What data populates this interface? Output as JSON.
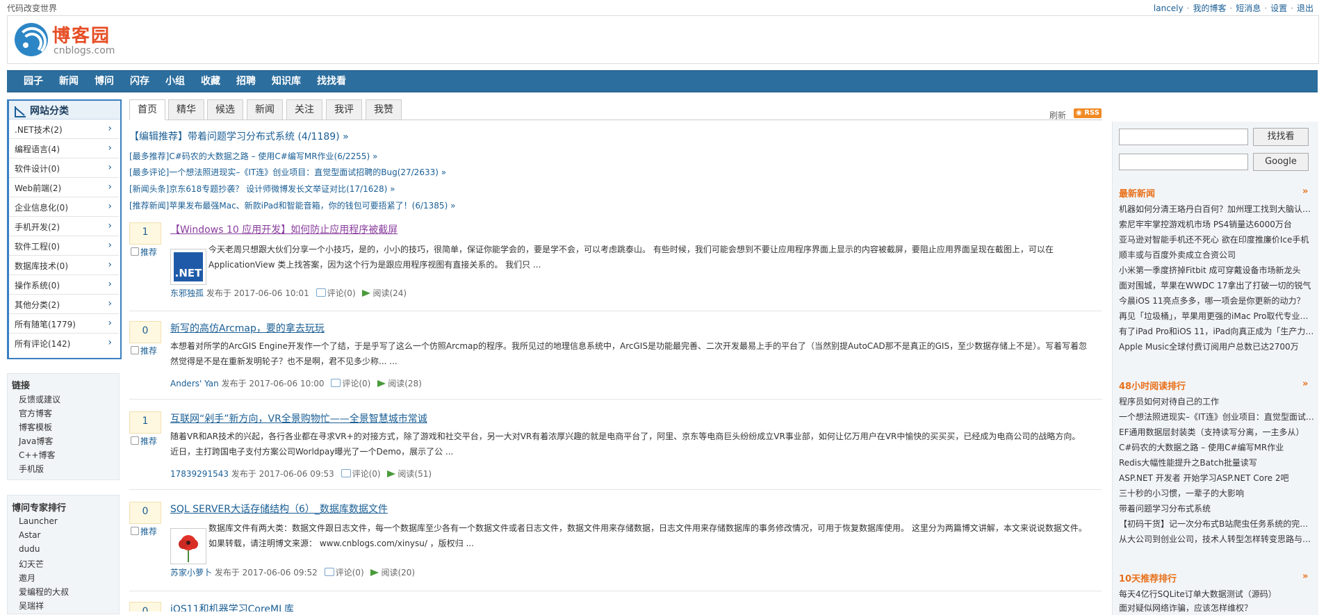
{
  "topbar": {
    "slogan": "代码改变世界",
    "links": [
      "lancely",
      "我的博客",
      "短消息",
      "设置",
      "退出"
    ]
  },
  "header": {
    "logo_title": "博客园",
    "logo_sub": "cnblogs.com"
  },
  "nav": [
    "园子",
    "新闻",
    "博问",
    "闪存",
    "小组",
    "收藏",
    "招聘",
    "知识库",
    "找找看"
  ],
  "categories": {
    "title": "网站分类",
    "items": [
      ".NET技术(2)",
      "编程语言(4)",
      "软件设计(0)",
      "Web前端(2)",
      "企业信息化(0)",
      "手机开发(2)",
      "软件工程(0)",
      "数据库技术(0)",
      "操作系统(0)",
      "其他分类(2)",
      "所有随笔(1779)",
      "所有评论(142)"
    ]
  },
  "links_box": {
    "title": "链接",
    "items": [
      "反馈或建议",
      "官方博客",
      "博客模板",
      "Java博客",
      "C++博客",
      "手机版"
    ]
  },
  "experts_box": {
    "title": "博问专家排行",
    "items": [
      "Launcher",
      "Astar",
      "dudu",
      "幻天芒",
      "邀月",
      "爱编程的大叔",
      "吴瑞祥"
    ]
  },
  "tabs": [
    "首页",
    "精华",
    "候选",
    "新闻",
    "关注",
    "我评",
    "我赞"
  ],
  "refresh_label": "刷新",
  "rss_label": "RSS",
  "headlines": {
    "main": "【编辑推荐】带着问题学习分布式系统 (4/1189) »",
    "items": [
      "[最多推荐]C#码农的大数据之路 – 使用C#编写MR作业(6/2255) »",
      "[最多评论]一个想法照进现实–《IT连》创业项目：直觉型面试招聘的Bug(27/2633) »",
      "[新闻头条]京东618专题抄袭？ 设计师微博发长文举证对比(17/1628) »",
      "[推荐新闻]苹果发布最强Mac、新款iPad和智能音箱，你的钱包可要捂紧了！(6/1385) »"
    ]
  },
  "posts": [
    {
      "digg": "1",
      "digg_label": "推荐",
      "title": "【Windows 10 应用开发】如何防止应用程序被截屏",
      "thumb": ".NET",
      "summary": "今天老周只想跟大伙们分享一个小技巧，是的，小小的技巧，很简单，保证你能学会的，要是学不会，可以考虑跳泰山。 有些时候，我们可能会想到不要让应用程序界面上显示的内容被截屏，要阻止应用界面呈现在截图上，可以在 ApplicationView 类上找答案，因为这个行为是跟应用程序视图有直接关系的。 我们只 ...",
      "author": "东邪独孤",
      "published": "发布于 2017-06-06 10:01",
      "comments": "评论(0)",
      "reads": "阅读(24)"
    },
    {
      "digg": "0",
      "digg_label": "推荐",
      "title": "新写的高仿Arcmap，要的拿去玩玩",
      "summary": "本想着对所学的ArcGIS Engine开发作一个了结，于是乎写了这么一个仿照Arcmap的程序。我所见过的地理信息系统中，ArcGIS是功能最完善、二次开发最易上手的平台了（当然别提AutoCAD那不是真正的GIS，至少数据存储上不是）。写着写着忽然觉得是不是在重新发明轮子？也不是啊，君不见多少称... ...",
      "author": "Anders' Yan",
      "published": "发布于 2017-06-06 10:00",
      "comments": "评论(0)",
      "reads": "阅读(28)"
    },
    {
      "digg": "1",
      "digg_label": "推荐",
      "title": "互联网“剁手”新方向，VR全景购物忙——全景智慧城市常诚",
      "summary": "随着VR和AR技术的兴起，各行各业都在寻求VR+的对接方式，除了游戏和社交平台，另一大对VR有着浓厚兴趣的就是电商平台了，阿里、京东等电商巨头纷纷成立VR事业部，如何让亿万用户在VR中愉快的买买买，已经成为电商公司的战略方向。近日，主打跨国电子支付方案公司Worldpay曝光了一个Demo，展示了公 ...",
      "author": "17839291543",
      "published": "发布于 2017-06-06 09:53",
      "comments": "评论(0)",
      "reads": "阅读(51)"
    },
    {
      "digg": "0",
      "digg_label": "推荐",
      "title": "SQL SERVER大话存储结构（6）_数据库数据文件",
      "summary": "数据库文件有两大类：数据文件跟日志文件，每一个数据库至少各有一个数据文件或者日志文件，数据文件用来存储数据，日志文件用来存储数据库的事务修改情况，可用于恢复数据库使用。 这里分为两篇博文讲解，本文来说说数据文件。 如果转载，请注明博文来源： www.cnblogs.com/xinysu/ ，版权归 ...",
      "author": "苏家小萝卜",
      "published": "发布于 2017-06-06 09:52",
      "comments": "评论(0)",
      "reads": "阅读(20)"
    },
    {
      "digg": "0",
      "title": "iOS11和机器学习CoreML库"
    }
  ],
  "search": {
    "btn1": "找找看",
    "btn2": "Google"
  },
  "news": {
    "title": "最新新闻",
    "more": "»",
    "items": [
      "机器如何分清王珞丹白百何？加州理工找到大脑认…",
      "索尼牢牢掌控游戏机市场 PS4销量达6000万台",
      "亚马逊对智能手机还不死心 欲在印度推廉价Ice手机",
      "顺丰或与百度外卖成立合资公司",
      "小米第一季度挤掉Fitbit 成可穿戴设备市场新龙头",
      "面对围城，苹果在WWDC 17拿出了打破一切的锐气",
      "今晨iOS 11亮点多多，哪一项会是你更新的动力？",
      "再见「垃圾桶」，苹果用更强的iMac Pro取代专业…",
      "有了iPad Pro和iOS 11，iPad向真正成为「生产力工…",
      "Apple Music全球付费订阅用户总数已达2700万"
    ]
  },
  "hot48": {
    "title": "48小时阅读排行",
    "more": "»",
    "items": [
      "程序员如何对待自己的工作",
      "一个想法照进现实–《IT连》创业项目：直觉型面试…",
      "EF通用数据层封装类（支持读写分离，一主多从）",
      "C#码农的大数据之路 – 使用C#编写MR作业",
      "Redis大幅性能提升之Batch批量读写",
      "ASP.NET 开发者 开始学习ASP.NET Core 2吧",
      "三十秒的小习惯，一辈子的大影响",
      "带着问题学习分布式系统",
      "【初码干货】记一次分布式B站爬虫任务系统的完整…",
      "从大公司到创业公司，技术人转型怎样转变思路与…"
    ]
  },
  "top10": {
    "title": "10天推荐排行",
    "more": "»",
    "items": [
      "每天4亿行SQLite订单大数据测试（源码）",
      "面对疑似网络诈骗，应该怎样维权？"
    ]
  }
}
